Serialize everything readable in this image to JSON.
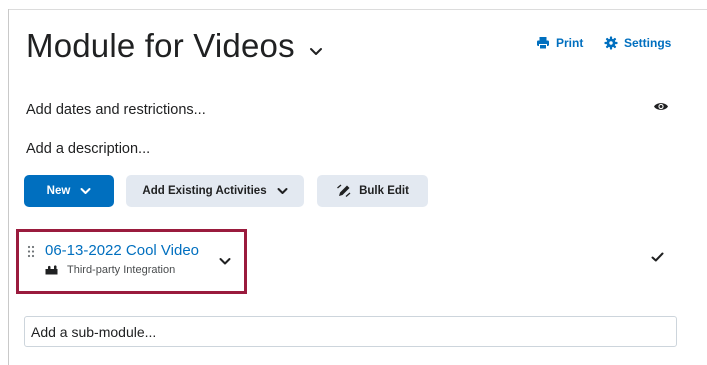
{
  "header": {
    "title": "Module for Videos",
    "actions": {
      "print_label": "Print",
      "settings_label": "Settings"
    }
  },
  "module": {
    "dates_label": "Add dates and restrictions...",
    "description_label": "Add a description..."
  },
  "toolbar": {
    "new_label": "New",
    "add_existing_label": "Add Existing Activities",
    "bulk_edit_label": "Bulk Edit"
  },
  "activity": {
    "title": "06-13-2022 Cool Video",
    "type": "Third-party Integration"
  },
  "submodule": {
    "placeholder": "Add a sub-module..."
  },
  "icons": {
    "title_chevron": "chevron-down-icon",
    "print": "printer-icon",
    "settings": "gear-icon",
    "visibility": "eye-icon",
    "bulk_edit": "pencil-icon",
    "drag": "drag-handle-icon",
    "integration": "puzzle-icon",
    "status": "checkmark-icon"
  },
  "colors": {
    "accent": "#006fbf",
    "secondary_button": "#e3e9f1",
    "highlight": "#9a1b3d"
  }
}
